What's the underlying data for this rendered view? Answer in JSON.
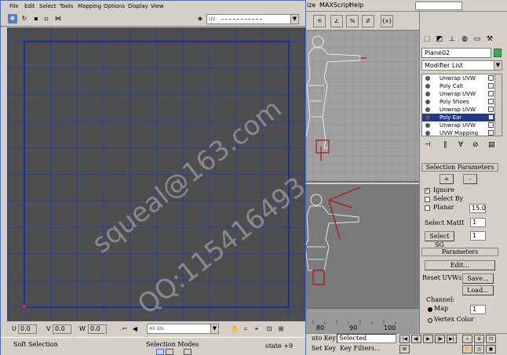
{
  "uv_editor": {
    "menu": [
      "File",
      "Edit",
      "Select",
      "Tools",
      "Mapping",
      "Options",
      "Display",
      "View"
    ],
    "toolbar_combo": "UV",
    "coords": [
      {
        "label": "U",
        "value": "0.0"
      },
      {
        "label": "V",
        "value": "0.0"
      },
      {
        "label": "W",
        "value": "0.0"
      }
    ],
    "selection_combo": "All IDs",
    "status": {
      "soft_selection": "Soft Selection",
      "selection_modes": "Selection Modes"
    }
  },
  "max": {
    "menu": [
      "ize",
      "MAXScript",
      "Help"
    ],
    "timeline_ticks": [
      "80",
      "90",
      "100"
    ],
    "bottom": {
      "auto_key": "uto Key",
      "selected": "Selected",
      "set_key": "Set Key",
      "key_filters": "Key Filters...",
      "rotate": "otate +9"
    }
  },
  "command_panel": {
    "object_name": "Plane02",
    "object_color": "#2db84a",
    "modifier_list": "Modifier List",
    "stack": [
      {
        "label": "Unwrap UVW",
        "selected": false
      },
      {
        "label": "Poly Calt",
        "selected": false
      },
      {
        "label": "Unwrap UVW",
        "selected": false
      },
      {
        "label": "Poly Shoes",
        "selected": false
      },
      {
        "label": "Unwrap UVW",
        "selected": false
      },
      {
        "label": "Poly Ear",
        "selected": true
      },
      {
        "label": "Unwrap UVW",
        "selected": false
      },
      {
        "label": "UVW Mapping",
        "selected": false
      }
    ],
    "selection_params": {
      "title": "Selection Parameters",
      "plus": "+",
      "minus": "-",
      "ignore": "Ignore",
      "select_by": "Select By",
      "planar": "Planar",
      "planar_value": "15.0",
      "select_matid": "Select MatII",
      "matid_value": "1",
      "select_sg": "Select SG",
      "sg_value": "1"
    },
    "parameters": {
      "title": "Parameters",
      "edit": "Edit...",
      "reset_uvws": "Reset UVWs",
      "save": "Save...",
      "load": "Load...",
      "channel": "Channel:",
      "map": "Map",
      "map_value": "1",
      "vertex_color": "Vertex Color"
    }
  },
  "watermark": {
    "line1": "squeal@163.com",
    "line2": "QQ:115416493"
  },
  "colors": {
    "grid_line": "#2a3ea8",
    "canvas": "#4e4e4e",
    "selection": "#1f3a8a",
    "window_border": "#3a6fd8"
  }
}
